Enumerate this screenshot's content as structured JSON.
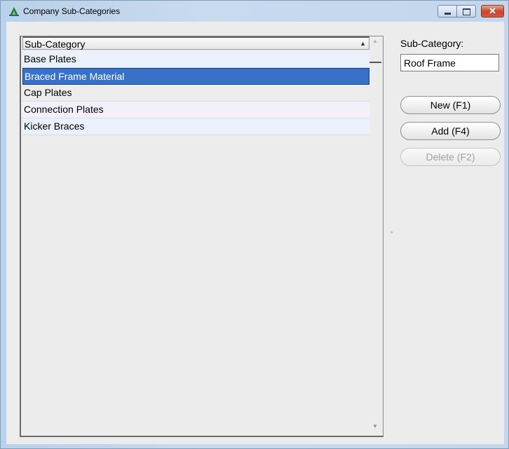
{
  "window": {
    "title": "Company Sub-Categories",
    "controls": {
      "minimize": "minimize",
      "maximize": "maximize",
      "close": "✕"
    }
  },
  "grid": {
    "header": "Sub-Category",
    "sort_indicator": "▲",
    "rows": [
      {
        "label": "Base Plates",
        "selected": false
      },
      {
        "label": "Braced Frame Material",
        "selected": true
      },
      {
        "label": "Cap Plates",
        "selected": false
      },
      {
        "label": "Connection Plates",
        "selected": false
      },
      {
        "label": "Kicker Braces",
        "selected": false
      }
    ],
    "row_colors": [
      "#eaf1fb",
      "#3872c8",
      "#ececec",
      "#f4f0fa",
      "#eaf1fb"
    ]
  },
  "form": {
    "subcategory_label": "Sub-Category:",
    "subcategory_value": "Roof Frame"
  },
  "buttons": {
    "new": "New (F1)",
    "add": "Add (F4)",
    "delete": "Delete (F2)"
  },
  "scrollbar": {
    "up": "▲",
    "down": "▼"
  },
  "colors": {
    "accent": "#3872c8",
    "title_bar": "#c4d6ec",
    "panel": "#ececec"
  }
}
